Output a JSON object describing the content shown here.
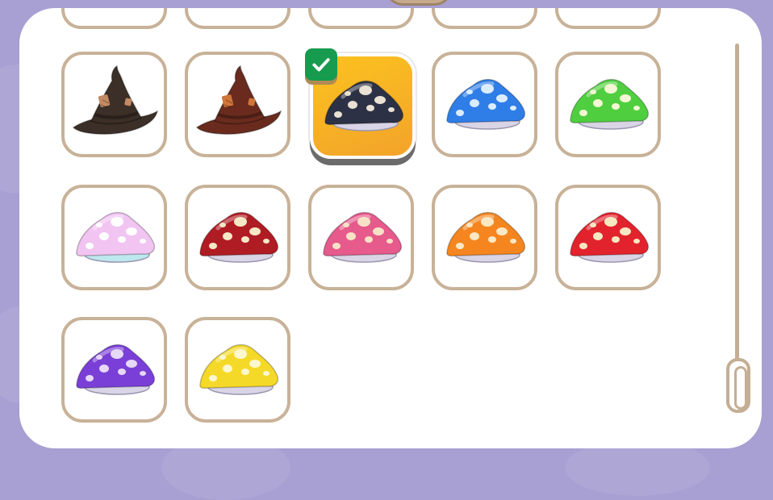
{
  "inventory": {
    "rows": [
      [
        {
          "id": "partial-1",
          "kind": "partial"
        },
        {
          "id": "partial-2",
          "kind": "partial"
        },
        {
          "id": "partial-3",
          "kind": "partial"
        },
        {
          "id": "partial-4",
          "kind": "partial"
        },
        {
          "id": "partial-5",
          "kind": "partial"
        }
      ],
      [
        {
          "id": "witch-hat-dark",
          "kind": "witch",
          "color": "#3b2f27",
          "patch": "#c48a63"
        },
        {
          "id": "witch-hat-brown",
          "kind": "witch",
          "color": "#6a2b1e",
          "patch": "#d1763a"
        },
        {
          "id": "mushroom-hat-navy",
          "kind": "mushroom",
          "color": "#2c3145",
          "spots": "#e9e1d3",
          "selected": true
        },
        {
          "id": "mushroom-hat-blue",
          "kind": "mushroom",
          "color": "#2f7ee8",
          "spots": "#dcecff"
        },
        {
          "id": "mushroom-hat-green",
          "kind": "mushroom",
          "color": "#4fcf3f",
          "spots": "#f3f7d3"
        }
      ],
      [
        {
          "id": "mushroom-hat-pastel",
          "kind": "mushroom",
          "color": "#f1c4f1",
          "spots": "#ffffff",
          "rim": "#bde8f0"
        },
        {
          "id": "mushroom-hat-crimson",
          "kind": "mushroom",
          "color": "#b01c24",
          "spots": "#f4e9c6"
        },
        {
          "id": "mushroom-hat-pink",
          "kind": "mushroom",
          "color": "#e65a8c",
          "spots": "#f8e2c7"
        },
        {
          "id": "mushroom-hat-orange",
          "kind": "mushroom",
          "color": "#f5861f",
          "spots": "#fbe8c5"
        },
        {
          "id": "mushroom-hat-red",
          "kind": "mushroom",
          "color": "#e2232d",
          "spots": "#f6e9c2"
        }
      ],
      [
        {
          "id": "mushroom-hat-purple",
          "kind": "mushroom",
          "color": "#7a3fd6",
          "spots": "#e7d8f7"
        },
        {
          "id": "mushroom-hat-yellow",
          "kind": "mushroom",
          "color": "#f5d928",
          "spots": "#fdf7cf"
        }
      ]
    ],
    "selected_item": "mushroom-hat-navy"
  },
  "icons": {
    "selected_badge": "check-icon",
    "scrollbar": "scroll-thumb"
  },
  "colors": {
    "background": "#a89fd2",
    "slot_border": "#c8b298",
    "selected_bg": "#f3a32a",
    "check_badge": "#179b4f",
    "scroll": "#c4ae94"
  },
  "scroll": {
    "position": 1.0
  }
}
